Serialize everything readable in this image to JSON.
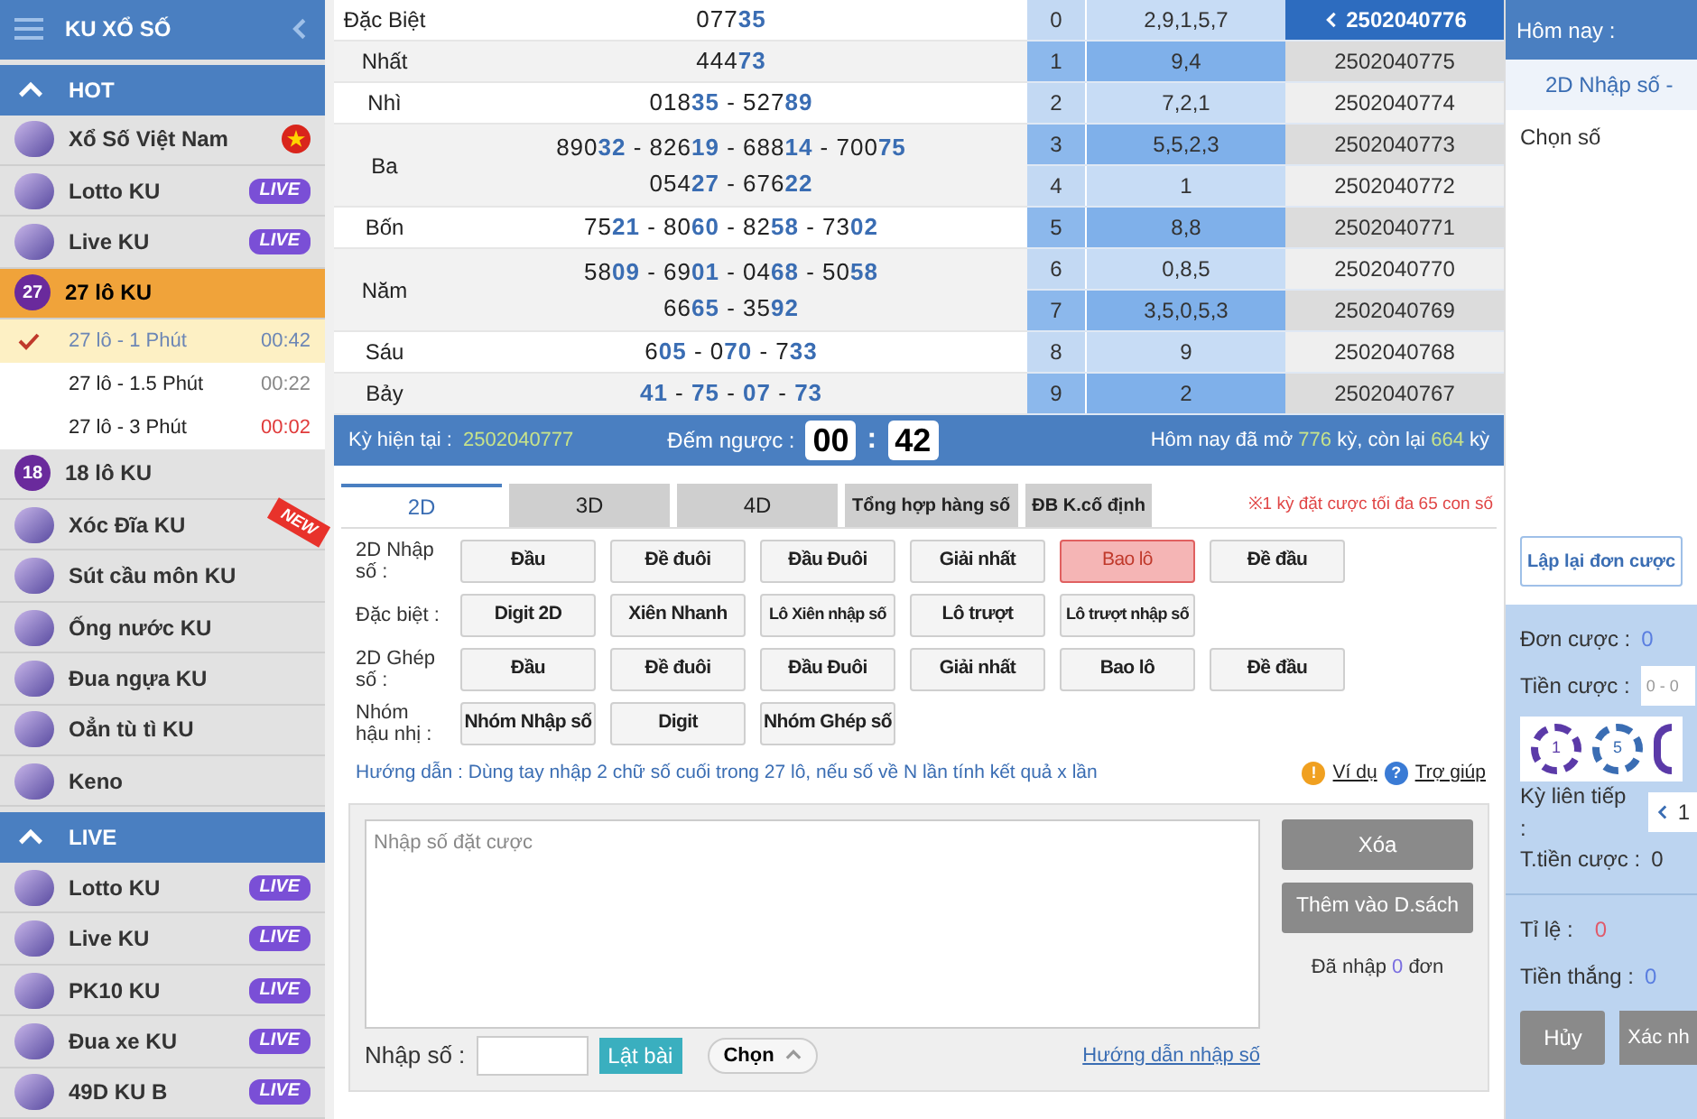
{
  "sidebar": {
    "title": "KU XỔ SỐ",
    "sections": [
      {
        "title": "HOT",
        "expanded": true,
        "items": [
          {
            "label": "Xổ Số Việt Nam",
            "kind": "flag",
            "selected": false
          },
          {
            "label": "Lotto KU",
            "badge": "LIVE",
            "selected": false
          },
          {
            "label": "Live KU",
            "badge": "LIVE",
            "selected": false
          },
          {
            "label": "27 lô KU",
            "icon_text": "27",
            "selected": true,
            "expanded": true,
            "children": [
              {
                "label": "27 lô - 1 Phút",
                "time": "00:42",
                "color": "#6c86b5",
                "selected": true
              },
              {
                "label": "27 lô - 1.5 Phút",
                "time": "00:22",
                "color": "#888888",
                "selected": false
              },
              {
                "label": "27 lô - 3 Phút",
                "time": "00:02",
                "color": "#e03a3a",
                "selected": false
              }
            ]
          },
          {
            "label": "18 lô KU",
            "icon_text": "18",
            "selected": false
          },
          {
            "label": "Xóc Đĩa KU",
            "ribbon": "NEW",
            "selected": false
          },
          {
            "label": "Sút cầu môn KU",
            "selected": false
          },
          {
            "label": "Ống nước KU",
            "selected": false
          },
          {
            "label": "Đua ngựa KU",
            "selected": false
          },
          {
            "label": "Oẳn tù tì KU",
            "selected": false
          },
          {
            "label": "Keno",
            "selected": false
          }
        ]
      },
      {
        "title": "LIVE",
        "expanded": true,
        "items": [
          {
            "label": "Lotto KU",
            "badge": "LIVE",
            "selected": false
          },
          {
            "label": "Live KU",
            "badge": "LIVE",
            "selected": false
          },
          {
            "label": "PK10 KU",
            "badge": "LIVE",
            "selected": false
          },
          {
            "label": "Đua xe KU",
            "badge": "LIVE",
            "selected": false
          },
          {
            "label": "49D KU B",
            "badge": "LIVE",
            "selected": false
          }
        ]
      }
    ]
  },
  "results": {
    "prizes": [
      {
        "name": "Đặc Biệt",
        "lines": [
          "077**35**"
        ]
      },
      {
        "name": "Nhất",
        "lines": [
          "444**73**"
        ]
      },
      {
        "name": "Nhì",
        "lines": [
          "018**35** - 527**89**"
        ]
      },
      {
        "name": "Ba",
        "lines": [
          "890**32** - 826**19** - 688**14** - 700**75**",
          "054**27** - 676**22**"
        ]
      },
      {
        "name": "Bốn",
        "lines": [
          "75**21** - 80**60** - 82**58** - 73**02**"
        ]
      },
      {
        "name": "Năm",
        "lines": [
          "58**09** - 69**01** - 04**68** - 50**58**",
          "66**65** - 35**92**"
        ]
      },
      {
        "name": "Sáu",
        "lines": [
          "6**05** - 0**70** - 7**33**"
        ]
      },
      {
        "name": "Bảy",
        "lines": [
          "**41** - **75** - **07** - **73**"
        ]
      }
    ],
    "digits": [
      {
        "digit": "0",
        "values": "2,9,1,5,7",
        "period": "2502040776",
        "selected": true
      },
      {
        "digit": "1",
        "values": "9,4",
        "period": "2502040775",
        "selected": false
      },
      {
        "digit": "2",
        "values": "7,2,1",
        "period": "2502040774",
        "selected": false
      },
      {
        "digit": "3",
        "values": "5,5,2,3",
        "period": "2502040773",
        "selected": false
      },
      {
        "digit": "4",
        "values": "1",
        "period": "2502040772",
        "selected": false
      },
      {
        "digit": "5",
        "values": "8,8",
        "period": "2502040771",
        "selected": false
      },
      {
        "digit": "6",
        "values": "0,8,5",
        "period": "2502040770",
        "selected": false
      },
      {
        "digit": "7",
        "values": "3,5,0,5,3",
        "period": "2502040769",
        "selected": false
      },
      {
        "digit": "8",
        "values": "9",
        "period": "2502040768",
        "selected": false
      },
      {
        "digit": "9",
        "values": "2",
        "period": "2502040767",
        "selected": false
      }
    ]
  },
  "status": {
    "current_label": "Kỳ hiện tại :",
    "current": "2502040777",
    "countdown_label": "Đếm ngược :",
    "minutes": "00",
    "separator": ":",
    "seconds": "42",
    "today_prefix": "Hôm nay đã mở",
    "opened": "776",
    "middle": "kỳ, còn lại",
    "remaining": "664",
    "suffix": "kỳ"
  },
  "tabs": [
    {
      "label": "2D",
      "selected": true
    },
    {
      "label": "3D",
      "selected": false
    },
    {
      "label": "4D",
      "selected": false
    },
    {
      "label": "Tổng hợp hàng số",
      "selected": false
    },
    {
      "label": "ĐB K.cố định",
      "selected": false
    }
  ],
  "limit_note": "※1 kỳ đặt cược tối đa 65 con số",
  "bet_groups": [
    {
      "label": "2D Nhập số :",
      "options": [
        {
          "label": "Đầu",
          "selected": false
        },
        {
          "label": "Đề đuôi",
          "selected": false
        },
        {
          "label": "Đầu Đuôi",
          "selected": false
        },
        {
          "label": "Giải nhất",
          "selected": false
        },
        {
          "label": "Bao lô",
          "selected": true
        },
        {
          "label": "Đề đầu",
          "selected": false
        }
      ]
    },
    {
      "label": "Đặc biệt :",
      "options": [
        {
          "label": "Digit 2D",
          "selected": false
        },
        {
          "label": "Xiên Nhanh",
          "selected": false
        },
        {
          "label": "Lô Xiên nhập số",
          "selected": false
        },
        {
          "label": "Lô trượt",
          "selected": false
        },
        {
          "label": "Lô trượt nhập số",
          "selected": false
        }
      ]
    },
    {
      "label": "2D Ghép số :",
      "options": [
        {
          "label": "Đầu",
          "selected": false
        },
        {
          "label": "Đề đuôi",
          "selected": false
        },
        {
          "label": "Đầu Đuôi",
          "selected": false
        },
        {
          "label": "Giải nhất",
          "selected": false
        },
        {
          "label": "Bao lô",
          "selected": false
        },
        {
          "label": "Đề đầu",
          "selected": false
        }
      ]
    },
    {
      "label": "Nhóm hậu nhị :",
      "options": [
        {
          "label": "Nhóm Nhập số",
          "selected": false
        },
        {
          "label": "Digit",
          "selected": false
        },
        {
          "label": "Nhóm Ghép số",
          "selected": false
        }
      ]
    }
  ],
  "guide": "Hướng dẫn : Dùng tay nhập 2 chữ số cuối trong 27 lô, nếu số về N lần tính kết quả x lần",
  "example_icon": "!",
  "example_link": "Ví dụ",
  "help_icon": "?",
  "help_link": "Trợ giúp",
  "entry": {
    "placeholder": "Nhập số đặt cược",
    "clear_button": "Xóa",
    "add_button": "Thêm vào D.sách",
    "entered_prefix": "Đã nhập",
    "entered_count": "0",
    "entered_suffix": "đơn",
    "number_label": "Nhập số :",
    "flip_button": "Lật bài",
    "choose_button": "Chọn",
    "guide_link": "Hướng dẫn nhập số"
  },
  "panel": {
    "header": "Hôm nay :",
    "game": "2D Nhập số -",
    "pick_label": "Chọn số",
    "repeat_button": "Lập lại đơn cược",
    "bet_count_label": "Đơn cược :",
    "bet_count": "0",
    "amount_label": "Tiền cược :",
    "amount_placeholder": "0 - 0",
    "chips": [
      "1",
      "5"
    ],
    "consecutive_label": "Kỳ liên tiếp :",
    "consecutive": "1",
    "total_label": "T.tiền cược :",
    "total": "0",
    "rate_label": "Tỉ lệ :",
    "rate": "0",
    "win_label": "Tiền thắng :",
    "win": "0",
    "cancel_button": "Hủy",
    "confirm_button": "Xác nh"
  }
}
